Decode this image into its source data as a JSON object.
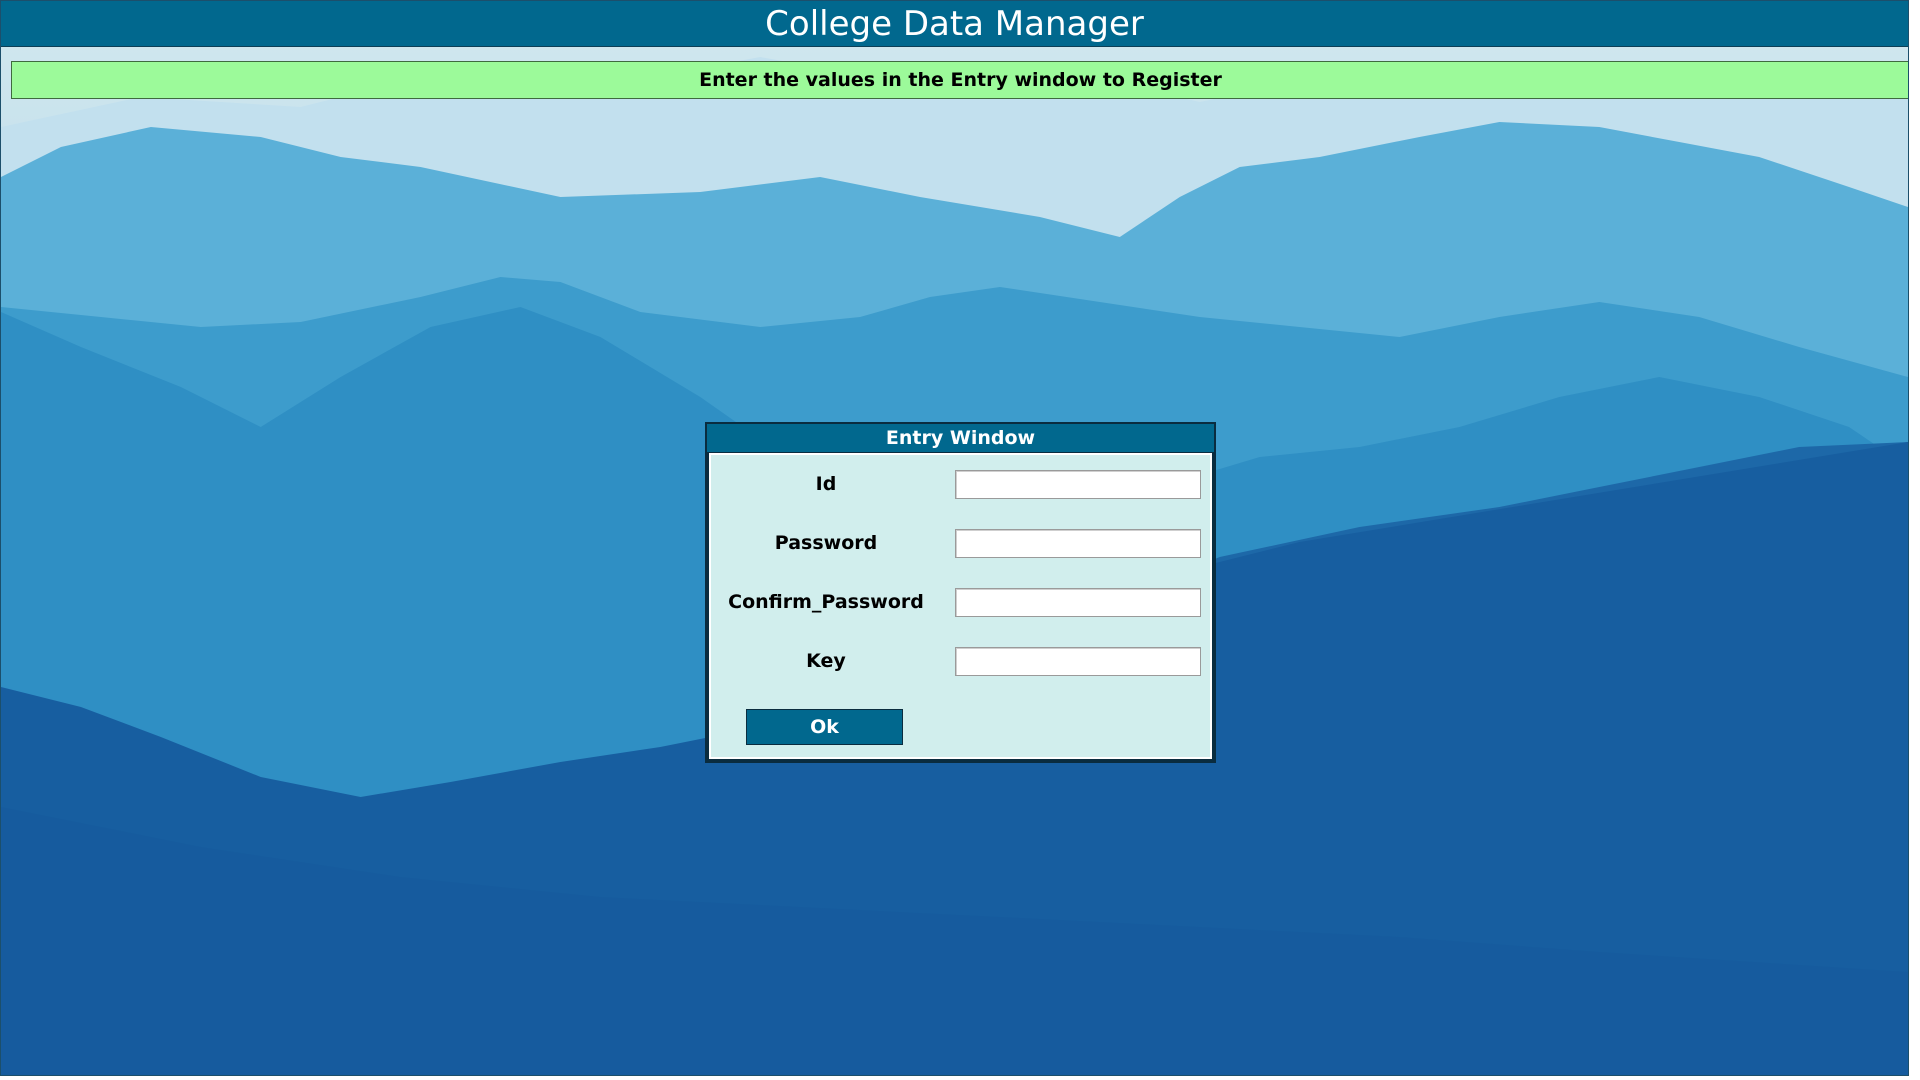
{
  "app": {
    "title": "College Data Manager"
  },
  "message": {
    "text": "Enter the values in the Entry window to Register"
  },
  "dialog": {
    "title": "Entry Window",
    "fields": [
      {
        "label": "Id",
        "value": "",
        "placeholder": ""
      },
      {
        "label": "Password",
        "value": "",
        "placeholder": ""
      },
      {
        "label": "Confirm_Password",
        "value": "",
        "placeholder": ""
      },
      {
        "label": "Key",
        "value": "",
        "placeholder": ""
      }
    ],
    "ok_label": "Ok"
  },
  "colors": {
    "title_bar": "#01688e",
    "message_bar": "#9cfa9a",
    "dialog_body": "#d1eeed",
    "button": "#01688e"
  }
}
